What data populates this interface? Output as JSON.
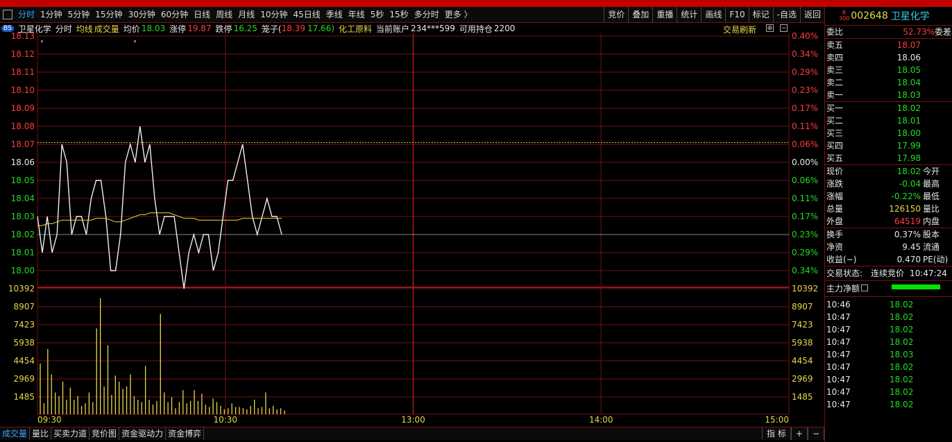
{
  "toolbar": {
    "tabs": [
      "分时",
      "1分钟",
      "5分钟",
      "15分钟",
      "30分钟",
      "60分钟",
      "日线",
      "周线",
      "月线",
      "10分钟",
      "45日线",
      "季线",
      "年线",
      "5秒",
      "15秒",
      "多分时",
      "更多 〉"
    ],
    "right_buttons": [
      "竞价",
      "叠加",
      "重播",
      "统计",
      "画线",
      "F10",
      "标记",
      "-自选",
      "返回"
    ]
  },
  "infobar": {
    "badge": "BS",
    "name": "卫星化学",
    "mode": "分时",
    "avg_line": "均线",
    "volume": "成交量",
    "avg_price_label": "均价",
    "avg_price": "18.03",
    "limit_up_label": "涨停",
    "limit_up": "19.87",
    "limit_down_label": "跌停",
    "limit_down": "16.25",
    "box_label": "笼子(",
    "box_hi": "18.39",
    "box_lo": "17.66)",
    "sector": "化工原料",
    "account_label": "当前账户",
    "account": "234***599",
    "avail_label": "可用持仓",
    "avail": "2200",
    "refresh": "交易刷新"
  },
  "chart_data": {
    "type": "line",
    "price_ticks": [
      "18.13",
      "18.12",
      "18.11",
      "18.10",
      "18.09",
      "18.08",
      "18.07",
      "18.06",
      "18.05",
      "18.04",
      "18.03",
      "18.02",
      "18.01",
      "18.00"
    ],
    "pct_ticks": [
      "0.40%",
      "0.34%",
      "0.29%",
      "0.23%",
      "0.17%",
      "0.11%",
      "0.06%",
      "0.00%",
      "0.06%",
      "0.11%",
      "0.17%",
      "0.23%",
      "0.29%",
      "0.34%"
    ],
    "volume_ticks": [
      "10392",
      "8907",
      "7423",
      "5938",
      "4454",
      "2969",
      "1485"
    ],
    "time_labels": [
      "09:30",
      "10:30",
      "13:00",
      "14:00",
      "15:00"
    ],
    "prev_close": 18.06,
    "current": 18.02,
    "price_series": [
      18.03,
      18.01,
      18.03,
      18.01,
      18.02,
      18.07,
      18.06,
      18.02,
      18.03,
      18.03,
      18.02,
      18.04,
      18.05,
      18.05,
      18.03,
      18.0,
      18.0,
      18.02,
      18.06,
      18.07,
      18.06,
      18.08,
      18.06,
      18.07,
      18.04,
      18.02,
      18.03,
      18.03,
      18.03,
      18.01,
      17.99,
      18.01,
      18.02,
      18.01,
      18.02,
      18.02,
      18.0,
      18.01,
      18.03,
      18.05,
      18.05,
      18.06,
      18.07,
      18.05,
      18.03,
      18.02,
      18.03,
      18.04,
      18.03,
      18.03,
      18.02
    ],
    "avg_series": [
      18.025,
      18.025,
      18.026,
      18.026,
      18.027,
      18.028,
      18.028,
      18.028,
      18.028,
      18.028,
      18.028,
      18.028,
      18.029,
      18.029,
      18.029,
      18.028,
      18.027,
      18.027,
      18.028,
      18.029,
      18.03,
      18.031,
      18.031,
      18.032,
      18.032,
      18.032,
      18.032,
      18.032,
      18.031,
      18.03,
      18.029,
      18.029,
      18.029,
      18.028,
      18.028,
      18.028,
      18.028,
      18.028,
      18.028,
      18.028,
      18.028,
      18.028,
      18.029,
      18.029,
      18.029,
      18.029,
      18.029,
      18.029,
      18.029,
      18.029,
      18.029
    ],
    "volume_series": [
      4200,
      900,
      5400,
      3300,
      1800,
      1500,
      2700,
      1200,
      2200,
      1200,
      1500,
      700,
      900,
      1800,
      1000,
      7100,
      9600,
      2300,
      5700,
      1600,
      3200,
      2700,
      2100,
      2300,
      3300,
      1500,
      1200,
      1000,
      4000,
      1200,
      800,
      1100,
      8300,
      1800,
      1000,
      1400,
      500,
      1000,
      2000,
      900,
      1100,
      2000,
      1100,
      1700,
      800,
      600,
      1300,
      1000,
      700,
      400,
      500,
      900,
      600,
      600,
      500,
      400,
      700,
      1200,
      500,
      600,
      1800,
      500,
      700,
      400,
      500,
      300
    ]
  },
  "bottombar": {
    "tabs": [
      "成交量",
      "量比",
      "买卖力道",
      "竞价图",
      "资金驱动力",
      "资金博弈"
    ],
    "right": [
      "指 标",
      "+",
      "−"
    ]
  },
  "quote": {
    "badge_top": "R",
    "badge_bottom": "300",
    "code": "002648",
    "name": "卫星化学",
    "weibi_label": "委比",
    "weibi": "52.73%",
    "weicha_label": "委差",
    "sells": [
      {
        "label": "卖五",
        "price": "18.07",
        "color": "#ff3c3c"
      },
      {
        "label": "卖四",
        "price": "18.06",
        "color": "#e8e8e8"
      },
      {
        "label": "卖三",
        "price": "18.05",
        "color": "#22dd22"
      },
      {
        "label": "卖二",
        "price": "18.04",
        "color": "#22dd22"
      },
      {
        "label": "卖一",
        "price": "18.03",
        "color": "#22dd22"
      }
    ],
    "buys": [
      {
        "label": "买一",
        "price": "18.02",
        "color": "#22dd22"
      },
      {
        "label": "买二",
        "price": "18.01",
        "color": "#22dd22"
      },
      {
        "label": "买三",
        "price": "18.00",
        "color": "#22dd22"
      },
      {
        "label": "买四",
        "price": "17.99",
        "color": "#22dd22"
      },
      {
        "label": "买五",
        "price": "17.98",
        "color": "#22dd22"
      }
    ],
    "stats": [
      {
        "label": "现价",
        "value": "18.02",
        "color": "#22dd22",
        "label2": "今开"
      },
      {
        "label": "涨跌",
        "value": "-0.04",
        "color": "#22dd22",
        "label2": "最高"
      },
      {
        "label": "涨幅",
        "value": "-0.22%",
        "color": "#22dd22",
        "label2": "最低"
      },
      {
        "label": "总量",
        "value": "126150",
        "color": "#e8d84a",
        "label2": "量比"
      },
      {
        "label": "外盘",
        "value": "64519",
        "color": "#ff3c3c",
        "label2": "内盘"
      }
    ],
    "stats2": [
      {
        "label": "换手",
        "value": "0.37%",
        "color": "#e8e8e8",
        "label2": "股本"
      },
      {
        "label": "净资",
        "value": "9.45",
        "color": "#e8e8e8",
        "label2": "流通"
      },
      {
        "label": "收益(−)",
        "value": "0.470",
        "color": "#e8e8e8",
        "label2": "PE(动)"
      }
    ],
    "trade_state_label": "交易状态:",
    "trade_state": "连续竞价",
    "trade_time": "10:47:24",
    "main_flow_label": "主力净额",
    "ticks": [
      {
        "time": "10:46",
        "price": "18.02"
      },
      {
        "time": "10:47",
        "price": "18.02"
      },
      {
        "time": "10:47",
        "price": "18.02"
      },
      {
        "time": "10:47",
        "price": "18.02"
      },
      {
        "time": "10:47",
        "price": "18.03"
      },
      {
        "time": "10:47",
        "price": "18.02"
      },
      {
        "time": "10:47",
        "price": "18.02"
      },
      {
        "time": "10:47",
        "price": "18.02"
      },
      {
        "time": "10:47",
        "price": "18.02"
      }
    ]
  }
}
